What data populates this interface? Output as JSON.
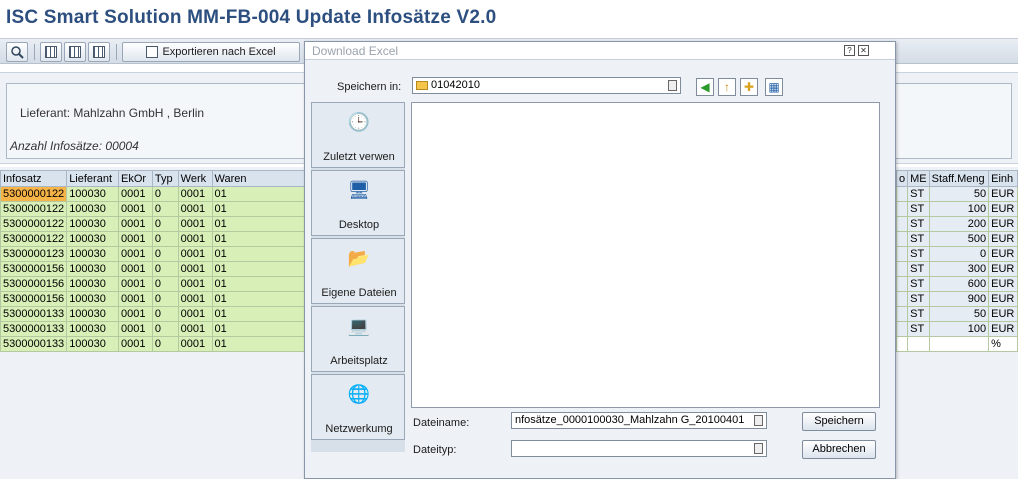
{
  "app": {
    "title": "ISC Smart Solution MM-FB-004 Update Infosätze V2.0"
  },
  "toolbar": {
    "export_label": "Exportieren nach Excel"
  },
  "header": {
    "lieferant": "Lieferant: Mahlzahn GmbH , Berlin",
    "anzahl": "Anzahl Infosätze: 00004"
  },
  "left_table": {
    "columns": [
      "Infosatz",
      "Lieferant",
      "EkOr",
      "Typ",
      "Werk",
      "Waren"
    ],
    "rows": [
      [
        "5300000122",
        "100030",
        "0001",
        "0",
        "0001",
        "01"
      ],
      [
        "5300000122",
        "100030",
        "0001",
        "0",
        "0001",
        "01"
      ],
      [
        "5300000122",
        "100030",
        "0001",
        "0",
        "0001",
        "01"
      ],
      [
        "5300000122",
        "100030",
        "0001",
        "0",
        "0001",
        "01"
      ],
      [
        "5300000123",
        "100030",
        "0001",
        "0",
        "0001",
        "01"
      ],
      [
        "5300000156",
        "100030",
        "0001",
        "0",
        "0001",
        "01"
      ],
      [
        "5300000156",
        "100030",
        "0001",
        "0",
        "0001",
        "01"
      ],
      [
        "5300000156",
        "100030",
        "0001",
        "0",
        "0001",
        "01"
      ],
      [
        "5300000133",
        "100030",
        "0001",
        "0",
        "0001",
        "01"
      ],
      [
        "5300000133",
        "100030",
        "0001",
        "0",
        "0001",
        "01"
      ],
      [
        "5300000133",
        "100030",
        "0001",
        "0",
        "0001",
        "01"
      ]
    ]
  },
  "right_table": {
    "columns": [
      "o",
      "ME",
      "Staff.Meng",
      "Einh"
    ],
    "rows": [
      [
        "",
        "ST",
        "50",
        "EUR"
      ],
      [
        "",
        "ST",
        "100",
        "EUR"
      ],
      [
        "",
        "ST",
        "200",
        "EUR"
      ],
      [
        "",
        "ST",
        "500",
        "EUR"
      ],
      [
        "",
        "ST",
        "0",
        "EUR"
      ],
      [
        "",
        "ST",
        "300",
        "EUR"
      ],
      [
        "",
        "ST",
        "600",
        "EUR"
      ],
      [
        "",
        "ST",
        "900",
        "EUR"
      ],
      [
        "",
        "ST",
        "50",
        "EUR"
      ],
      [
        "",
        "ST",
        "100",
        "EUR"
      ],
      [
        "",
        "",
        "",
        "%"
      ]
    ]
  },
  "dialog": {
    "title": "Download Excel",
    "save_in_label": "Speichern in:",
    "save_in_value": "01042010",
    "places": [
      "Zuletzt verwen",
      "Desktop",
      "Eigene Dateien",
      "Arbeitsplatz",
      "Netzwerkumg"
    ],
    "filename_label": "Dateiname:",
    "filename_value": "nfosätze_0000100030_Mahlzahn G_20100401",
    "filetype_label": "Dateityp:",
    "filetype_value": "",
    "save_button": "Speichern",
    "cancel_button": "Abbrechen"
  }
}
